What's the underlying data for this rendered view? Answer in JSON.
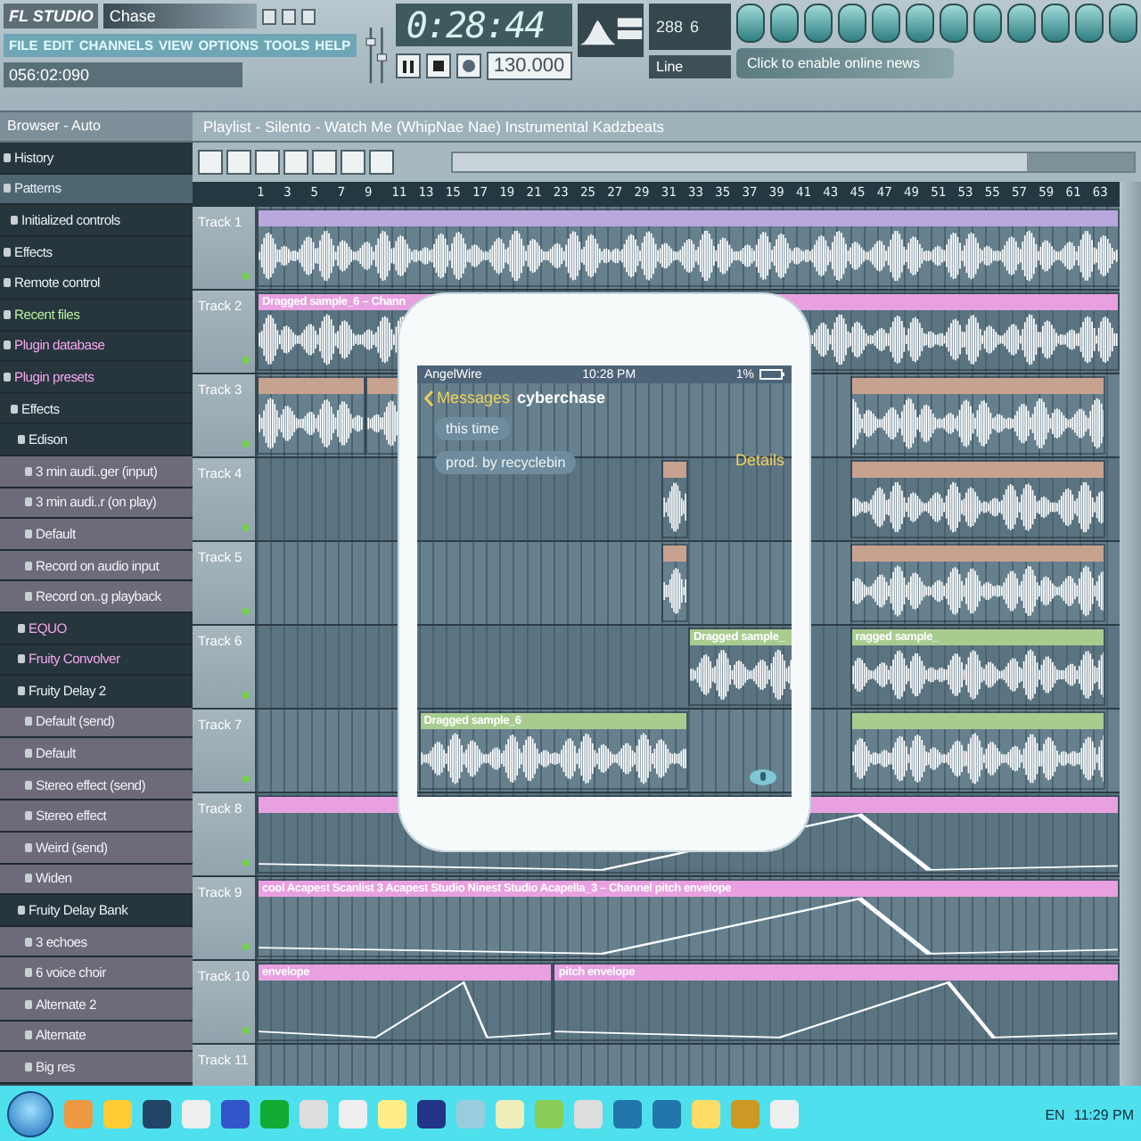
{
  "toolbar": {
    "logo": "FL STUDIO",
    "pattern": "Chase",
    "menu": [
      "FILE",
      "EDIT",
      "CHANNELS",
      "VIEW",
      "OPTIONS",
      "TOOLS",
      "HELP"
    ],
    "song_position": "056:02:090",
    "time": "0:28:44",
    "tempo": "130.000",
    "cpu": "288",
    "poly": "6",
    "input": "Line",
    "news": "Click to enable online news"
  },
  "browser": {
    "title": "Browser - Auto",
    "items": [
      {
        "label": "History",
        "kind": "folder",
        "selected": false
      },
      {
        "label": "Patterns",
        "kind": "folder",
        "selected": true,
        "children": [
          {
            "label": "Initialized controls",
            "kind": "folder",
            "selected": false
          }
        ]
      },
      {
        "label": "Effects",
        "kind": "folder",
        "selected": false
      },
      {
        "label": "Remote control",
        "kind": "folder",
        "selected": false
      },
      {
        "label": "Recent files",
        "kind": "recent",
        "selected": false
      },
      {
        "label": "Plugin database",
        "kind": "plugin",
        "selected": false
      },
      {
        "label": "Plugin presets",
        "kind": "plugin",
        "selected": false,
        "children": [
          {
            "label": "Effects",
            "kind": "folder",
            "selected": false,
            "children": [
              {
                "label": "Edison",
                "kind": "folder",
                "selected": false,
                "children": [
                  {
                    "label": "3 min audi..ger (input)",
                    "kind": "preset",
                    "selected": false
                  },
                  {
                    "label": "3 min audi..r (on play)",
                    "kind": "preset",
                    "selected": false
                  },
                  {
                    "label": "Default",
                    "kind": "preset",
                    "selected": false
                  },
                  {
                    "label": "Record on audio input",
                    "kind": "preset",
                    "selected": false
                  },
                  {
                    "label": "Record on..g playback",
                    "kind": "preset",
                    "selected": false
                  }
                ]
              },
              {
                "label": "EQUO",
                "kind": "plugin",
                "selected": false
              },
              {
                "label": "Fruity Convolver",
                "kind": "plugin",
                "selected": false
              },
              {
                "label": "Fruity Delay 2",
                "kind": "folder",
                "selected": false,
                "children": [
                  {
                    "label": "Default (send)",
                    "kind": "preset",
                    "selected": false
                  },
                  {
                    "label": "Default",
                    "kind": "preset",
                    "selected": false
                  },
                  {
                    "label": "Stereo effect (send)",
                    "kind": "preset",
                    "selected": false
                  },
                  {
                    "label": "Stereo effect",
                    "kind": "preset",
                    "selected": false
                  },
                  {
                    "label": "Weird (send)",
                    "kind": "preset",
                    "selected": false
                  },
                  {
                    "label": "Widen",
                    "kind": "preset",
                    "selected": false
                  }
                ]
              },
              {
                "label": "Fruity Delay Bank",
                "kind": "folder",
                "selected": false,
                "children": [
                  {
                    "label": "3 echoes",
                    "kind": "preset",
                    "selected": false
                  },
                  {
                    "label": "6 voice choir",
                    "kind": "preset",
                    "selected": false
                  },
                  {
                    "label": "Alternate 2",
                    "kind": "preset",
                    "selected": false
                  },
                  {
                    "label": "Alternate",
                    "kind": "preset",
                    "selected": false
                  },
                  {
                    "label": "Big res",
                    "kind": "preset",
                    "selected": false
                  }
                ]
              }
            ]
          }
        ]
      }
    ]
  },
  "playlist": {
    "title": "Playlist - Silento - Watch Me (WhipNae Nae) Instrumental Kadzbeats",
    "ruler": [
      "1",
      "3",
      "5",
      "7",
      "9",
      "11",
      "13",
      "15",
      "17",
      "19",
      "21",
      "23",
      "25",
      "27",
      "29",
      "31",
      "33",
      "35",
      "37",
      "39",
      "41",
      "43",
      "45",
      "47",
      "49",
      "51",
      "53",
      "55",
      "57",
      "59",
      "61",
      "63"
    ],
    "tracks": [
      {
        "name": "Track 1",
        "clips": [
          {
            "kind": "audio",
            "color": "#b8a8dc"
          }
        ]
      },
      {
        "name": "Track 2",
        "clips": [
          {
            "kind": "audio",
            "color": "#e8a0e0",
            "label": "Dragged sample_6 – Chann"
          }
        ]
      },
      {
        "name": "Track 3",
        "clips": [
          {
            "kind": "audio",
            "color": "#c8a290"
          },
          {
            "kind": "audio",
            "color": "#c8a290"
          },
          {
            "kind": "audio",
            "color": "#c8a290"
          }
        ]
      },
      {
        "name": "Track 4",
        "clips": [
          {
            "kind": "audio",
            "color": "#c8a290"
          },
          {
            "kind": "audio",
            "color": "#c8a290"
          }
        ]
      },
      {
        "name": "Track 5",
        "clips": [
          {
            "kind": "audio",
            "color": "#c8a290"
          },
          {
            "kind": "audio",
            "color": "#c8a290"
          }
        ]
      },
      {
        "name": "Track 6",
        "clips": [
          {
            "kind": "audio",
            "color": "#a8cc90",
            "label": "Dragged sample_"
          },
          {
            "kind": "audio",
            "color": "#a8cc90",
            "label": "ragged sample_"
          }
        ]
      },
      {
        "name": "Track 7",
        "clips": [
          {
            "kind": "audio",
            "color": "#a8cc90",
            "label": "Dragged sample_6"
          },
          {
            "kind": "audio",
            "color": "#a8cc90"
          }
        ]
      },
      {
        "name": "Track 8",
        "clips": [
          {
            "kind": "envelope",
            "color": "#e8a0e0"
          }
        ]
      },
      {
        "name": "Track 9",
        "clips": [
          {
            "kind": "envelope",
            "color": "#e8a0e0",
            "label": "cool Acapest Scanlist 3 Acapest Studio Ninest Studio Acapella_3 – Channel pitch envelope"
          }
        ]
      },
      {
        "name": "Track 10",
        "clips": [
          {
            "kind": "envelope",
            "color": "#e8a0e0",
            "label": "envelope"
          },
          {
            "kind": "envelope",
            "color": "#e8a0e0",
            "label": "pitch envelope"
          }
        ]
      },
      {
        "name": "Track 11"
      }
    ]
  },
  "phone": {
    "carrier": "AngelWire",
    "time": "10:28 PM",
    "battery": "1%",
    "back": "Messages",
    "contact": "cyberchase",
    "details": "Details",
    "messages": [
      "this time",
      "prod. by recyclebin"
    ]
  },
  "taskbar": {
    "language": "EN",
    "clock": "11:29 PM"
  }
}
